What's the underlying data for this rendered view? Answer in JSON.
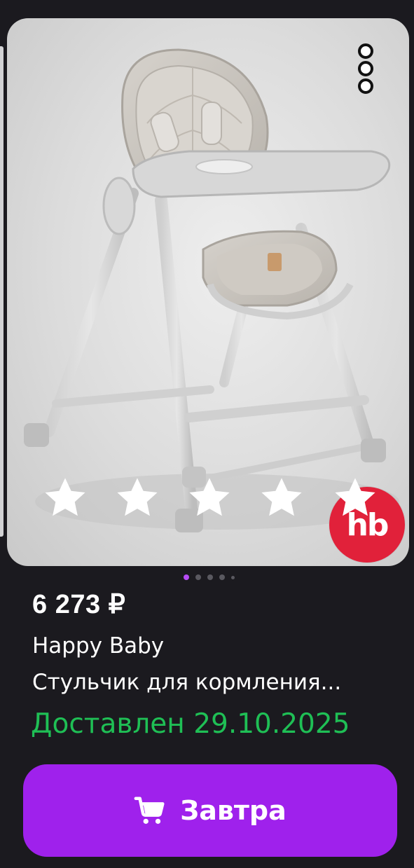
{
  "product": {
    "price": "6 273 ₽",
    "brand": "Happy Baby",
    "title": "Стульчик для кормления...",
    "delivery_status": "Доставлен 29.10.2025",
    "rating_stars": 5,
    "brand_badge": "hb",
    "image_icon": "high-chair-photo"
  },
  "gallery": {
    "page_count": 5,
    "active_index": 0
  },
  "actions": {
    "buy_button_label": "Завтра",
    "buy_button_icon": "cart-icon",
    "more_icon": "more-vertical-icon"
  },
  "colors": {
    "background": "#1b1a1f",
    "accent": "#9f21ec",
    "delivery_green": "#1fbf55",
    "badge_red": "#e1213a",
    "pager_active": "#b64cf5"
  }
}
